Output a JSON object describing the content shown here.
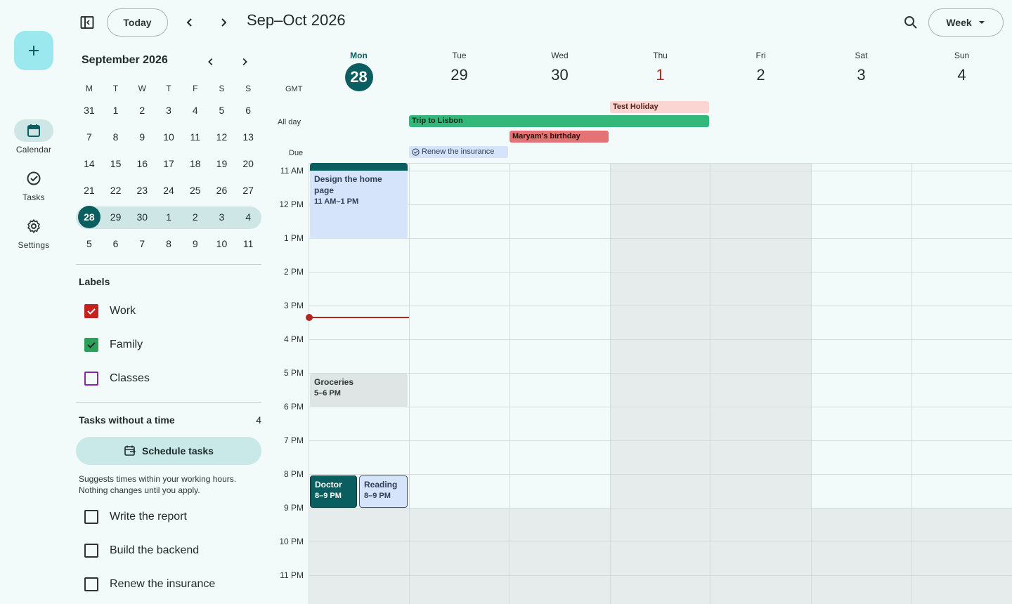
{
  "rail": {
    "create_label": "+",
    "items": [
      {
        "label": "Calendar",
        "icon": "calendar-icon"
      },
      {
        "label": "Tasks",
        "icon": "task-check-icon"
      },
      {
        "label": "Settings",
        "icon": "gear-icon"
      }
    ]
  },
  "topbar": {
    "today_label": "Today",
    "range_title": "Sep–Oct 2026",
    "view_label": "Week"
  },
  "mini_cal": {
    "title": "September 2026",
    "weekdays": [
      "M",
      "T",
      "W",
      "T",
      "F",
      "S",
      "S"
    ],
    "weeks": [
      [
        "31",
        "1",
        "2",
        "3",
        "4",
        "5",
        "6"
      ],
      [
        "7",
        "8",
        "9",
        "10",
        "11",
        "12",
        "13"
      ],
      [
        "14",
        "15",
        "16",
        "17",
        "18",
        "19",
        "20"
      ],
      [
        "21",
        "22",
        "23",
        "24",
        "25",
        "26",
        "27"
      ],
      [
        "28",
        "29",
        "30",
        "1",
        "2",
        "3",
        "4"
      ],
      [
        "5",
        "6",
        "7",
        "8",
        "9",
        "10",
        "11"
      ]
    ]
  },
  "labels": {
    "title": "Labels",
    "items": [
      {
        "label": "Work",
        "checked": true,
        "color": "#c5221f"
      },
      {
        "label": "Family",
        "checked": true,
        "color": "#2e9e5b"
      },
      {
        "label": "Classes",
        "checked": false,
        "color": "#8e24aa"
      }
    ]
  },
  "tasks": {
    "title": "Tasks without a time",
    "count": "4",
    "schedule_label": "Schedule tasks",
    "hint": "Suggests times within your working hours. Nothing changes until you apply.",
    "items": [
      {
        "label": "Write the report"
      },
      {
        "label": "Build the backend"
      },
      {
        "label": "Renew the insurance"
      }
    ]
  },
  "week": {
    "gmt": "GMT",
    "all_day_label": "All day",
    "due_label": "Due",
    "days": [
      {
        "dow": "Mon",
        "num": "28"
      },
      {
        "dow": "Tue",
        "num": "29"
      },
      {
        "dow": "Wed",
        "num": "30"
      },
      {
        "dow": "Thu",
        "num": "1"
      },
      {
        "dow": "Fri",
        "num": "2"
      },
      {
        "dow": "Sat",
        "num": "3"
      },
      {
        "dow": "Sun",
        "num": "4"
      }
    ],
    "all_day_events": {
      "test_holiday": "Test Holiday",
      "trip": "Trip to Lisbon",
      "birthday": "Maryam's birthday",
      "due_task": "Renew the insurance"
    },
    "hours": [
      "11 AM",
      "12 PM",
      "1 PM",
      "2 PM",
      "3 PM",
      "4 PM",
      "5 PM",
      "6 PM",
      "7 PM",
      "8 PM",
      "9 PM",
      "10 PM",
      "11 PM"
    ],
    "events": {
      "design": {
        "title": "Design the home page",
        "time": "11 AM–1 PM"
      },
      "groceries": {
        "title": "Groceries",
        "time": "5–6 PM"
      },
      "doctor": {
        "title": "Doctor",
        "time": "8–9 PM"
      },
      "reading": {
        "title": "Reading",
        "time": "8–9 PM"
      }
    }
  },
  "colors": {
    "accent": "#0b5e5f",
    "fab": "#9be9ee",
    "holiday_chip": "#fbd5d1",
    "trip_chip": "#34b87a",
    "birthday_chip": "#e57373",
    "due_chip": "#d5e4fb",
    "design_event": "#d5e4fb",
    "groceries_event": "#dfe5e4",
    "now_line": "#b3261e"
  }
}
